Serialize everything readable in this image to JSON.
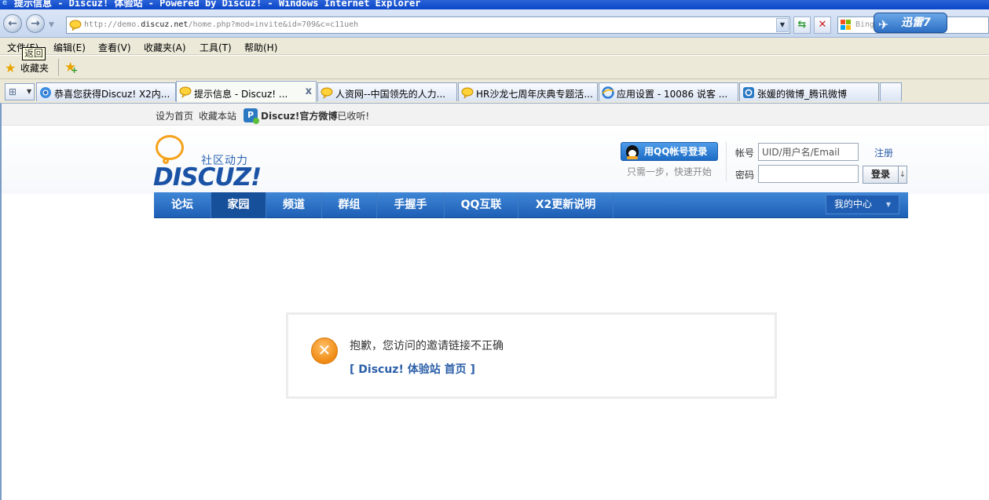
{
  "window": {
    "title": "提示信息 - Discuz! 体验站 - Powered by Discuz! - Windows Internet Explorer"
  },
  "toolbar": {
    "address_url_prefix": "http://demo.",
    "address_url_domain": "discuz.net",
    "address_url_path": "/home.php?mod=invite&id=709&c=c11ueh",
    "search_placeholder": "Bing",
    "xunlei_label": "迅雷7"
  },
  "menubar": {
    "items": [
      "文件(F)",
      "编辑(E)",
      "查看(V)",
      "收藏夹(A)",
      "工具(T)",
      "帮助(H)"
    ],
    "tooltip": "返回"
  },
  "favorites": {
    "label": "收藏夹"
  },
  "tabs": [
    {
      "label": "恭喜您获得Discuz! X2内...",
      "active": false
    },
    {
      "label": "提示信息 - Discuz! ...",
      "active": true
    },
    {
      "label": "人资网--中国领先的人力...",
      "active": false
    },
    {
      "label": "HR沙龙七周年庆典专题活...",
      "active": false
    },
    {
      "label": "应用设置 - 10086 说客 ...",
      "active": false
    },
    {
      "label": "张媛的微博_腾讯微博",
      "active": false
    }
  ],
  "site": {
    "toplinks": {
      "set_home": "设为首页",
      "bookmark": "收藏本站",
      "weibo_name": "Discuz!官方微博",
      "weibo_suffix": "已收听!"
    },
    "logo": {
      "tagline": "社区动力",
      "wordmark": "DISCUZ!"
    },
    "qq_login": {
      "button": "用QQ帐号登录",
      "hint": "只需一步，快速开始"
    },
    "login": {
      "account_label": "帐号",
      "account_value": "UID/用户名/Email",
      "password_label": "密码",
      "password_value": "",
      "register": "注册",
      "submit": "登录",
      "submit_arrow": "↓"
    },
    "nav": {
      "items": [
        "论坛",
        "家园",
        "频道",
        "群组",
        "手握手",
        "QQ互联",
        "X2更新说明"
      ],
      "active_index": 1,
      "my_center": "我的中心"
    },
    "message": {
      "text": "抱歉，您访问的邀请链接不正确",
      "link": "[ Discuz! 体验站 首页 ]"
    }
  },
  "colors": {
    "nav_blue": "#1d5fb6",
    "link_blue": "#2b5fa8",
    "error_orange": "#f08a12",
    "logo_orange": "#f4a21b"
  }
}
